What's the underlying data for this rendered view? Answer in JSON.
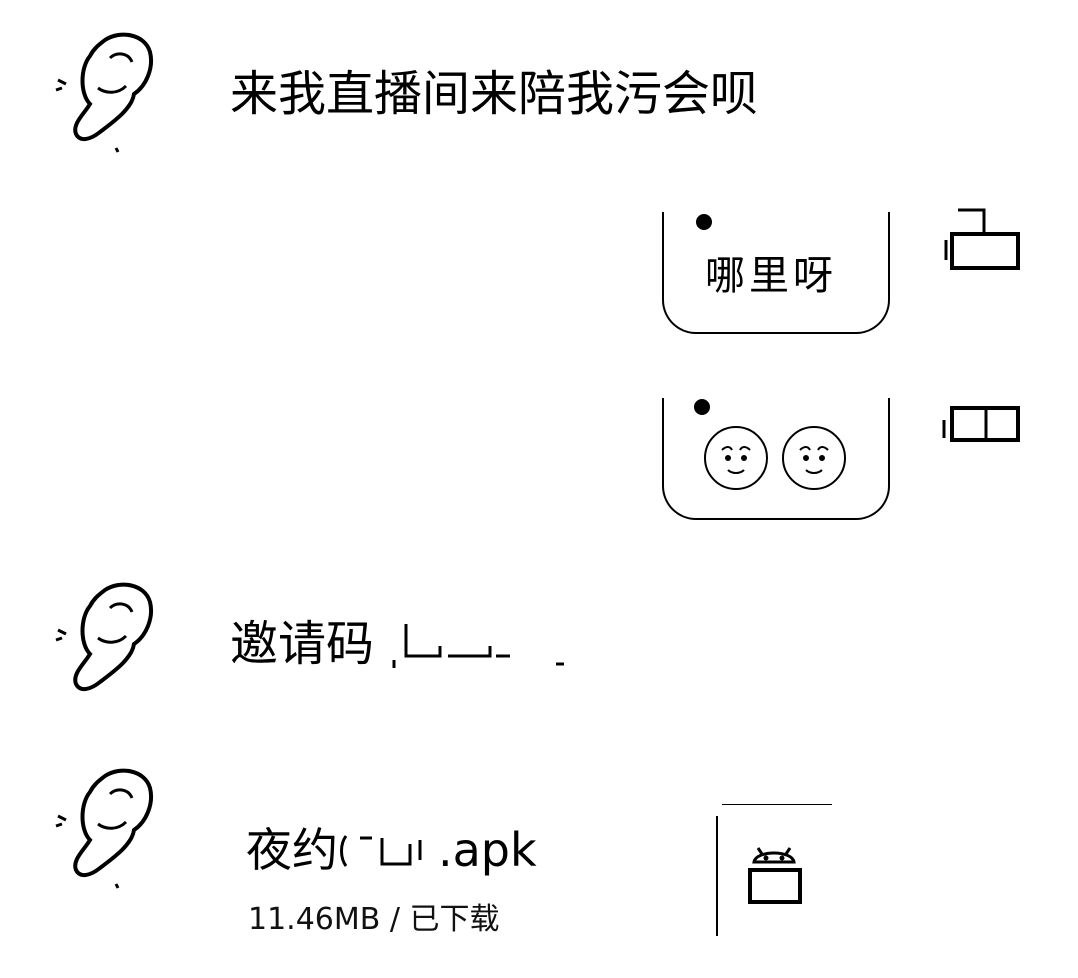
{
  "messages": {
    "m1": {
      "text": "来我直播间来陪我污会呗",
      "avatar_icon": "sketch-avatar-icon"
    },
    "m2": {
      "text": "哪里呀"
    },
    "m3": {
      "emoji": [
        "pleading-face-icon",
        "pleading-face-icon"
      ]
    },
    "m4": {
      "text": "邀请码"
    },
    "m5": {
      "file_name_prefix": "夜约",
      "file_name_suffix": ".apk",
      "file_meta": "11.46MB / 已下载",
      "file_icon": "android-icon"
    }
  },
  "colors": {
    "ink": "#000000",
    "background": "#ffffff"
  }
}
